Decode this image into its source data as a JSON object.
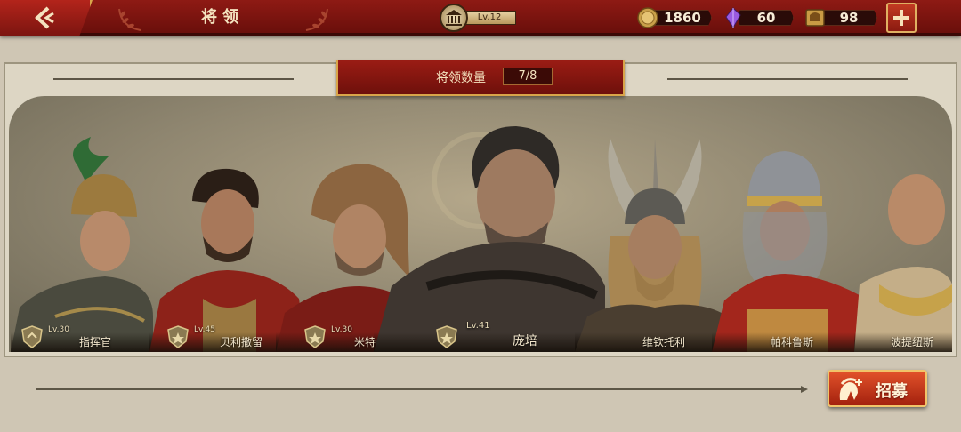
{
  "header": {
    "title": "将领",
    "back_icon": "chevron-left-icon",
    "level_label": "Lv.12",
    "resources": {
      "coins": "1860",
      "gems": "60",
      "tokens": "98"
    },
    "add_icon": "plus-icon"
  },
  "panel": {
    "count_label": "将领数量",
    "count_value": "7/8"
  },
  "generals": [
    {
      "name": "指挥官",
      "level": "Lv.30"
    },
    {
      "name": "贝利撒留",
      "level": "Lv.45"
    },
    {
      "name": "米特",
      "level": "Lv.30"
    },
    {
      "name": "庞培",
      "level": "Lv.41"
    },
    {
      "name": "维钦托利",
      "level": ""
    },
    {
      "name": "帕科鲁斯",
      "level": ""
    },
    {
      "name": "波提纽斯",
      "level": ""
    }
  ],
  "recruit": {
    "label": "招募",
    "icon": "spartan-helmet-plus-icon"
  },
  "colors": {
    "topbar": "#7c1510",
    "gold_border": "#d9a54a",
    "recruit_button": "#d04020"
  }
}
